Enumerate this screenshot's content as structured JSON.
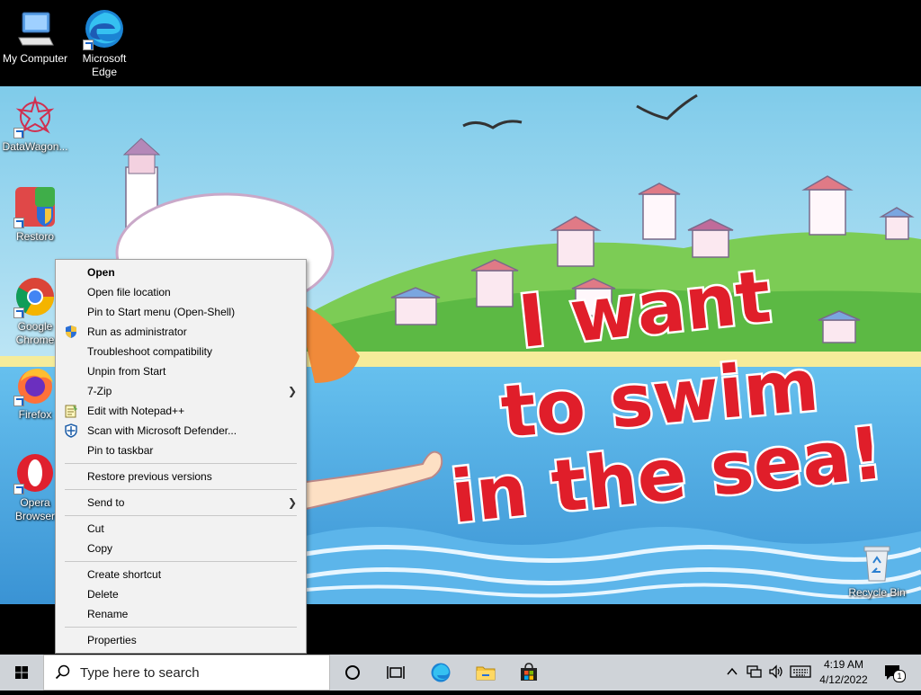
{
  "desktop": {
    "icons": [
      {
        "label": "My Computer",
        "icon": "computer-icon",
        "shortcut": false
      },
      {
        "label": "Microsoft Edge",
        "icon": "edge-icon",
        "shortcut": true
      },
      {
        "label": "DataWagon...",
        "icon": "datawagon-icon",
        "shortcut": true
      },
      {
        "label": "Restoro",
        "icon": "restoro-icon",
        "shortcut": true
      },
      {
        "label": "Google Chrome",
        "icon": "chrome-icon",
        "shortcut": true
      },
      {
        "label": "Firefox",
        "icon": "firefox-icon",
        "shortcut": true
      },
      {
        "label": "Opera Browser",
        "icon": "opera-icon",
        "shortcut": true
      },
      {
        "label": "Recycle Bin",
        "icon": "recycle-bin-icon",
        "shortcut": false
      }
    ]
  },
  "wallpaper": {
    "text_line1": "I want",
    "text_line2": "to swim",
    "text_line3": "in the sea!"
  },
  "context_menu": {
    "items": {
      "open": "Open",
      "open_file_location": "Open file location",
      "pin_to_start": "Pin to Start menu (Open-Shell)",
      "run_as_admin": "Run as administrator",
      "troubleshoot": "Troubleshoot compatibility",
      "unpin_from_start": "Unpin from Start",
      "seven_zip": "7-Zip",
      "edit_notepad": "Edit with Notepad++",
      "scan_defender": "Scan with Microsoft Defender...",
      "pin_taskbar": "Pin to taskbar",
      "restore_versions": "Restore previous versions",
      "send_to": "Send to",
      "cut": "Cut",
      "copy": "Copy",
      "create_shortcut": "Create shortcut",
      "delete": "Delete",
      "rename": "Rename",
      "properties": "Properties"
    }
  },
  "taskbar": {
    "search_placeholder": "Type here to search",
    "time": "4:19 AM",
    "date": "4/12/2022",
    "notification_count": "1"
  },
  "colors": {
    "taskbar_bg": "#cfd3d8",
    "menu_bg": "#f2f2f2",
    "sky": "#8fd3ee",
    "sea": "#4aa3dd",
    "title_red": "#e01e2a"
  }
}
